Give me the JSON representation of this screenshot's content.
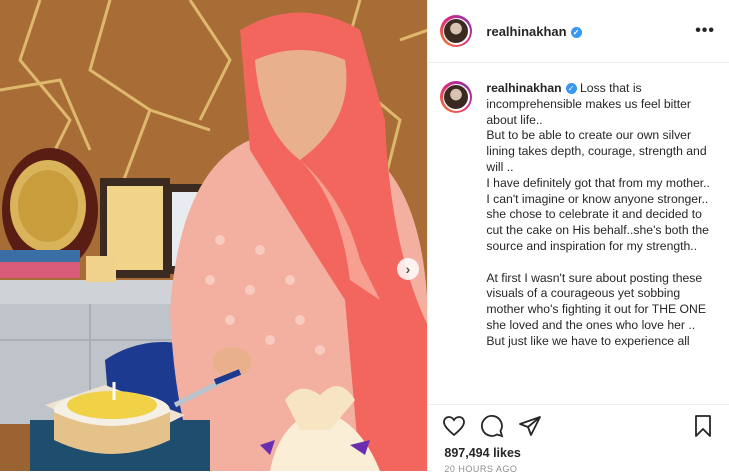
{
  "header": {
    "username": "realhinakhan",
    "more_label": "•••"
  },
  "caption": {
    "username": "realhinakhan",
    "paragraph1": "Loss that is incomprehensible makes us feel bitter about life..",
    "paragraph2": "But to be able to create our own silver lining takes depth, courage, strength and will ..",
    "paragraph3": "I have definitely got that from my mother.. I can't imagine or know anyone stronger.. she chose to celebrate it and decided to cut the cake on His behalf..she's both the source and inspiration for my strength..",
    "paragraph4": "At first I wasn't sure about posting these visuals of a courageous yet sobbing mother who's fighting it out for THE ONE she loved and the ones who love her ..",
    "paragraph5": "But just like we have to experience all"
  },
  "actions": {
    "likes": "897,494 likes",
    "date": "20 HOURS AGO"
  },
  "icons": {
    "like": "heart-icon",
    "comment": "comment-icon",
    "share": "paper-plane-icon",
    "save": "bookmark-icon",
    "verified": "verified-badge-icon",
    "next": "chevron-right-icon"
  },
  "colors": {
    "verified": "#3897f0",
    "text": "#262626",
    "muted": "#8e8e8e",
    "border": "#efefef"
  }
}
